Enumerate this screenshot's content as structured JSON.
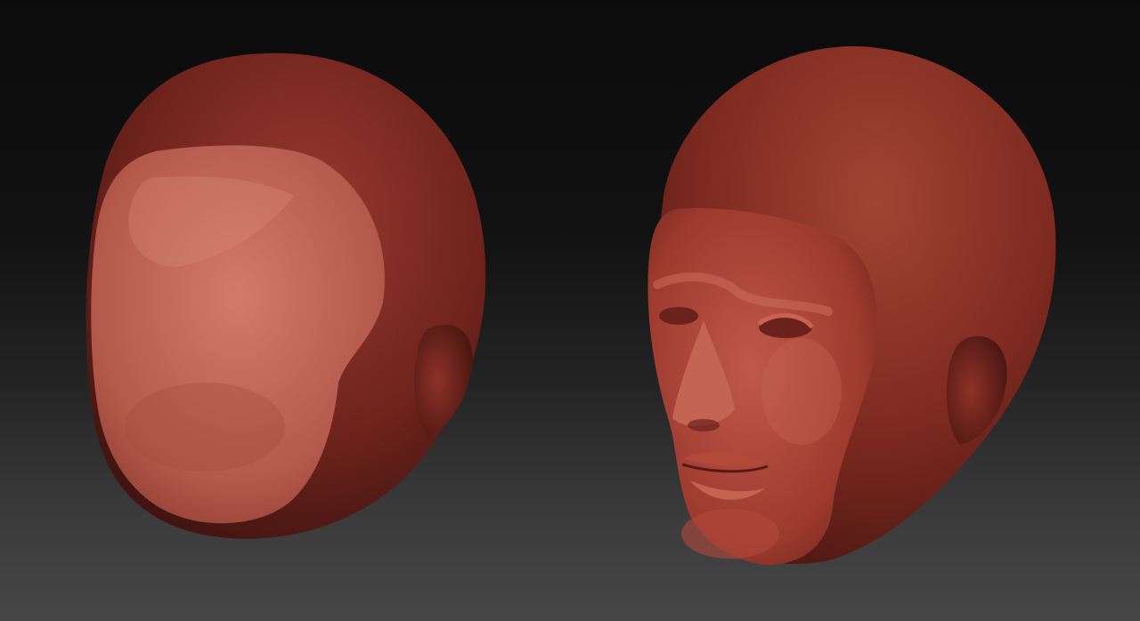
{
  "viewport": {
    "background_top": "#0b0b0b",
    "background_bottom": "#474747"
  },
  "models": [
    {
      "name": "head-left",
      "description_state": "face-region-raised",
      "base_color": "#8a2a22",
      "face_color": "#c9685c"
    },
    {
      "name": "head-right",
      "description_state": "face-sculpted",
      "base_color": "#8a2a22",
      "face_color": "#b04a3c"
    }
  ]
}
